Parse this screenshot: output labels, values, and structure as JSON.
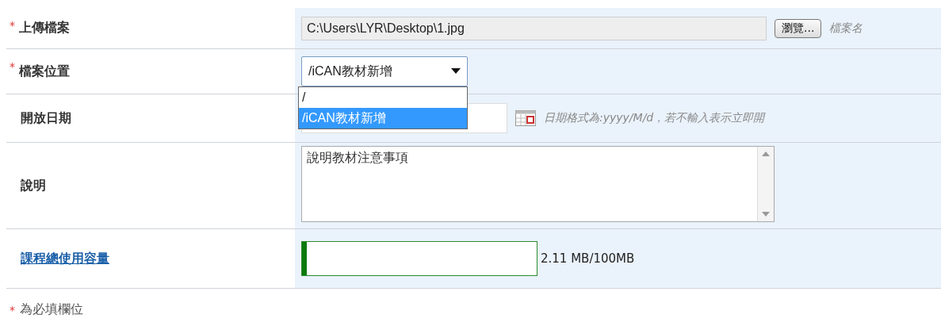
{
  "fields": [
    {
      "kind": "file",
      "mark": "*",
      "label": "上傳檔案",
      "value": "C:\\Users\\LYR\\Desktop\\1.jpg",
      "button": "瀏覽...",
      "hint": "檔案名"
    },
    {
      "kind": "select",
      "mark": "*",
      "label": "檔案位置",
      "value": "/iCAN教材新增",
      "expanded": true,
      "options": [
        {
          "label": "/",
          "selected": false
        },
        {
          "label": "/iCAN教材新增",
          "selected": true
        }
      ]
    },
    {
      "kind": "date",
      "label": "開放日期",
      "hint": "日期格式為:yyyy/M/d，若不輸入表示立即開"
    },
    {
      "kind": "textarea",
      "label": "說明",
      "value": "說明教材注意事項"
    },
    {
      "kind": "usage",
      "label": "課程總使用容量",
      "level": 0.0211,
      "reading": "2.11 MB/100MB"
    }
  ],
  "footnote": {
    "mark": "*",
    "text": "為必填欄位"
  }
}
